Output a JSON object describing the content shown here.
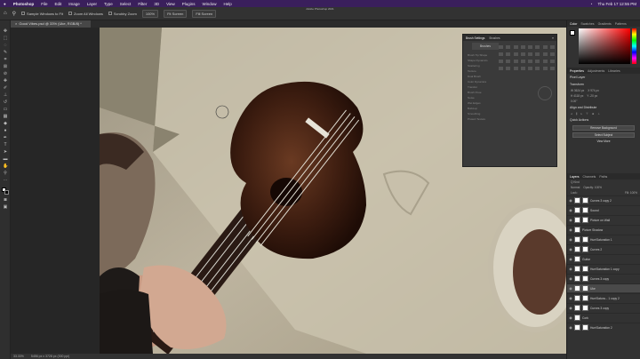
{
  "macbar": {
    "app": "Photoshop",
    "menus": [
      "File",
      "Edit",
      "Image",
      "Layer",
      "Type",
      "Select",
      "Filter",
      "3D",
      "View",
      "Plugins",
      "Window",
      "Help"
    ],
    "clock": "Thu Feb 17 12:55 PM"
  },
  "window_title": "Adobe Photoshop 2021",
  "options": {
    "sample_all": "Sample All Layers",
    "enhance_edge": "Enhance Edge",
    "select_subject": "Select Subject",
    "zoom": "100%",
    "fit_screen": "Fit Screen",
    "fill_screen": "Fill Screen",
    "sample_label": "Sample Windows to Fit",
    "zoom_all": "Zoom All Windows",
    "scrubby": "Scrubby Zoom"
  },
  "doc_tab": "Good Vibes.psd @ 33% (Uke, RGB/8) *",
  "status": {
    "zoom": "33.33%",
    "info": "5456 px x 3728 px (300 ppi)"
  },
  "right_panel": {
    "color_tabs": [
      "Color",
      "Swatches",
      "Gradients",
      "Patterns"
    ],
    "props_tabs": [
      "Properties",
      "Adjustments",
      "Libraries"
    ],
    "pixel_layer": "Pixel Layer",
    "transform": "Transform",
    "w": "W 3624 px",
    "h": "H 4118 px",
    "x": "X 974 px",
    "y": "Y -20 px",
    "angle": "0.00°",
    "align": "Align and Distribute",
    "quick_actions": "Quick Actions",
    "actions": [
      "Remove Background",
      "Select Subject",
      "View More"
    ],
    "layers_tabs": [
      "Layers",
      "Channels",
      "Paths"
    ],
    "kind": "Q Kind",
    "blend": "Normal",
    "opacity": "Opacity: 100%",
    "fill": "Fill: 100%",
    "lock": "Lock:",
    "layers": [
      "Curves 3 copy 2",
      "Sound",
      "Picture on Wall",
      "Picture Shadow",
      "Hue/Saturation 1",
      "Curves 2",
      "Guitar",
      "Hue/Saturation 1 copy",
      "Curves 3 copy",
      "Uke",
      "Hue/Satura... 1 copy 2",
      "Curves 3 copy",
      "Cork",
      "Hue/Saturation 2"
    ]
  },
  "float_panel": {
    "tabs": [
      "Brush Settings",
      "Brushes"
    ],
    "brushes": "Brushes",
    "options": [
      "Brush Tip Shape",
      "Shape Dynamics",
      "Scattering",
      "Texture",
      "Dual Brush",
      "Color Dynamics",
      "Transfer",
      "Brush Pose",
      "Noise",
      "Wet Edges",
      "Build-up",
      "Smoothing",
      "Protect Texture"
    ]
  },
  "colors": {
    "menubar": "#3a1f5c",
    "panel": "#323232",
    "canvas_bg": "#b6ad97"
  }
}
